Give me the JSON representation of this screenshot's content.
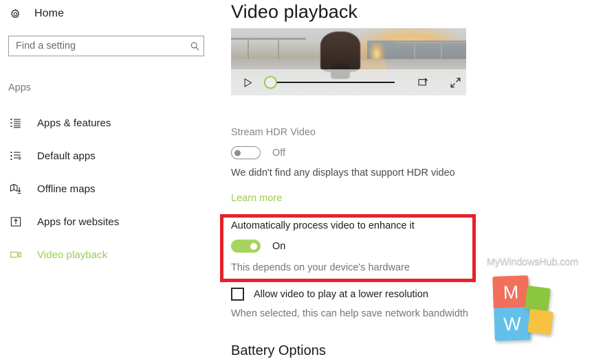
{
  "sidebar": {
    "home": {
      "label": "Home",
      "icon": "gear-icon"
    },
    "search": {
      "value": "",
      "placeholder": "Find a setting",
      "icon": "search-icon"
    },
    "group_label": "Apps",
    "items": [
      {
        "label": "Apps & features",
        "icon": "list-icon",
        "active": false
      },
      {
        "label": "Default apps",
        "icon": "list-arrow-icon",
        "active": false
      },
      {
        "label": "Offline maps",
        "icon": "map-download-icon",
        "active": false
      },
      {
        "label": "Apps for websites",
        "icon": "box-up-arrow-icon",
        "active": false
      },
      {
        "label": "Video playback",
        "icon": "video-camera-icon",
        "active": true
      }
    ]
  },
  "main": {
    "title": "Video playback",
    "video_preview": {
      "scene": "person walking on a pier at sunset",
      "play_icon": "play-icon",
      "cast_icon": "cast-icon",
      "fullscreen_icon": "fullscreen-icon",
      "progress_percent": 0
    },
    "hdr": {
      "label": "Stream HDR Video",
      "toggle_state": "Off",
      "toggle_on": false,
      "description": "We didn't find any displays that support HDR video",
      "link": "Learn more"
    },
    "enhance": {
      "label": "Automatically process video to enhance it",
      "toggle_state": "On",
      "toggle_on": true,
      "description": "This depends on your device's hardware",
      "highlighted": true
    },
    "lower_resolution": {
      "label": "Allow video to play at a lower resolution",
      "checked": false,
      "description": "When selected, this can help save network bandwidth"
    },
    "battery_section_title": "Battery Options"
  },
  "watermark": {
    "text": "MyWindowsHub.com",
    "letter_top": "M",
    "letter_bottom": "W"
  },
  "colors": {
    "accent_green": "#9acd4e",
    "toggle_on": "#a6d55f",
    "highlight_red": "#e8202a",
    "logo_red": "#f0705a",
    "logo_blue": "#63c0ea",
    "logo_green": "#8cc63e",
    "logo_yellow": "#f7c242"
  }
}
